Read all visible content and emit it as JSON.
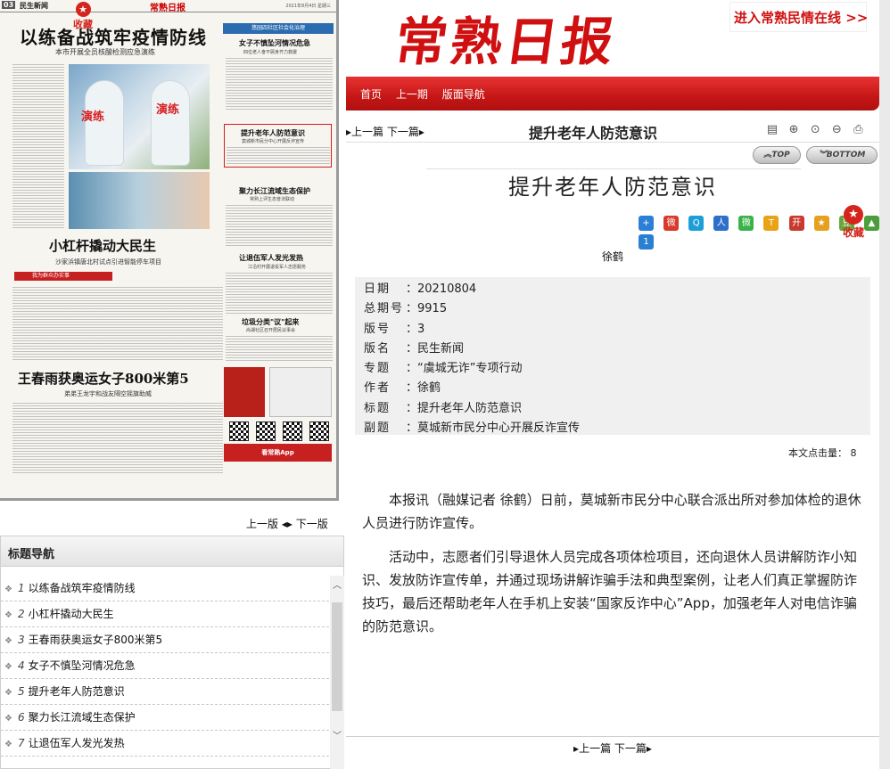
{
  "left": {
    "paper": {
      "page_num": "03",
      "section": "民生新闻",
      "masthead": "常熟日报",
      "date_line": "2021年8月4日 星期三",
      "fav_label": "收藏",
      "headline1": "以练备战筑牢疫情防线",
      "subhead1": "本市开展全员核酸检测应急演练",
      "photo_tag": "演练",
      "headline2": "小杠杆撬动大民生",
      "subhead2": "沙家浜镇唐北村试点引进智能停车项目",
      "red_banner": "我为群众办实事",
      "headline3": "王春雨获奥运女子800米第5",
      "subhead3": "弟弟王龙宇和战友隔空摇旗助威",
      "rcol_banner": "悠园四社区社会化治理",
      "rcol_h1": "女子不慎坠河情况危急",
      "rcol_s1": "四位老人奋不顾身齐力救援",
      "rcol_h2": "提升老年人防范意识",
      "rcol_s2": "莫城新市民分中心开展反诈宣传",
      "rcol_h3": "聚力长江流域生态保护",
      "rcol_s3": "常熟上评生态普法联动",
      "rcol_h4": "让退伍军人发光发热",
      "rcol_s4": "江沿村开展退役军人志愿服务",
      "rcol_h5": "垃圾分类\"议\"起来",
      "rcol_s5": "尚湖社区召开居民议事会",
      "ad_text": "看常熟App"
    },
    "pager": {
      "prev": "上一版",
      "next": "下一版"
    },
    "title_nav": {
      "header": "标题导航",
      "items": [
        {
          "num": "1",
          "label": "以练备战筑牢疫情防线"
        },
        {
          "num": "2",
          "label": "小杠杆撬动大民生"
        },
        {
          "num": "3",
          "label": "王春雨获奥运女子800米第5"
        },
        {
          "num": "4",
          "label": "女子不慎坠河情况危急"
        },
        {
          "num": "5",
          "label": "提升老年人防范意识"
        },
        {
          "num": "6",
          "label": "聚力长江流域生态保护"
        },
        {
          "num": "7",
          "label": "让退伍军人发光发热"
        }
      ]
    }
  },
  "right": {
    "masthead": "常熟日报",
    "enter_link": "进入常熟民情在线 >>",
    "nav": {
      "home": "首页",
      "prev": "上一期",
      "layout_nav": "版面导航"
    },
    "toolbar": {
      "prev": "上一篇",
      "next": "下一篇",
      "title": "提升老年人防范意识"
    },
    "top_btn": "TOP",
    "bottom_btn": "BOTTOM",
    "article_title": "提升老年人防范意识",
    "fav_label": "收藏",
    "author": "徐鹤",
    "meta": [
      {
        "key": "日期",
        "value": "20210804"
      },
      {
        "key": "总期号",
        "value": "9915"
      },
      {
        "key": "版号",
        "value": "3"
      },
      {
        "key": "版名",
        "value": "民生新闻"
      },
      {
        "key": "专题",
        "value": "“虞城无诈”专项行动"
      },
      {
        "key": "作者",
        "value": "徐鹤"
      },
      {
        "key": "标题",
        "value": "提升老年人防范意识"
      },
      {
        "key": "副题",
        "value": "莫城新市民分中心开展反诈宣传"
      }
    ],
    "hits_label": "本文点击量：",
    "hits_value": "8",
    "body": [
      "本报讯（融媒记者 徐鹤）日前，莫城新市民分中心联合派出所对参加体检的退休人员进行防诈宣传。",
      "活动中，志愿者们引导退休人员完成各项体检项目，还向退休人员讲解防诈小知识、发放防诈宣传单，并通过现场讲解诈骗手法和典型案例，让老人们真正掌握防诈技巧，最后还帮助老年人在手机上安装“国家反诈中心”App，加强老年人对电信诈骗的防范意识。"
    ],
    "bottom_nav": {
      "prev": "上一篇",
      "next": "下一篇"
    },
    "colors": {
      "brand_red": "#d01010",
      "accent_blue": "#2b6cb0"
    }
  }
}
